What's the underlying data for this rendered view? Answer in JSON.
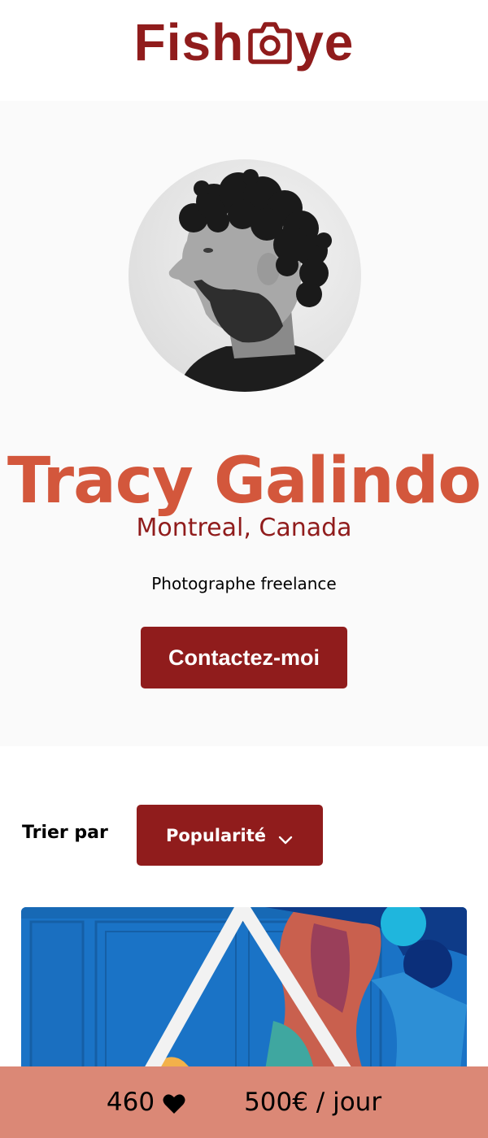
{
  "header": {
    "logo_text_left": "Fish",
    "logo_text_right": "ye",
    "logo_icon": "camera-icon",
    "brand_color": "#901C1C"
  },
  "profile": {
    "name": "Tracy Galindo",
    "location": "Montreal, Canada",
    "tagline": "Photographe freelance",
    "contact_label": "Contactez-moi",
    "accent_color": "#D3573C"
  },
  "sort": {
    "label": "Trier par",
    "selected": "Popularité",
    "icon": "chevron-down-icon"
  },
  "stats": {
    "likes": "460",
    "like_icon": "heart-icon",
    "price": "500€ / jour",
    "bar_color": "#DB8876"
  }
}
